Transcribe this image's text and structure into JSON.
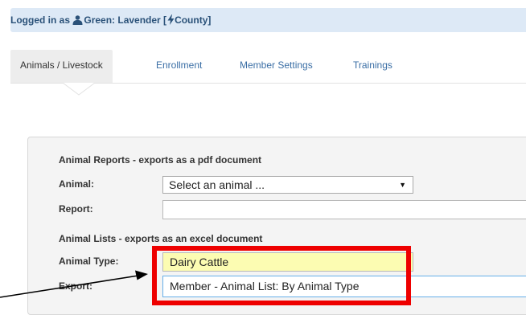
{
  "login_bar": {
    "prefix": "Logged in as",
    "user": "Green: Lavender [",
    "county": "County]"
  },
  "tabs": [
    {
      "label": "Animals / Livestock",
      "active": true
    },
    {
      "label": "Enrollment",
      "active": false
    },
    {
      "label": "Member Settings",
      "active": false
    },
    {
      "label": "Trainings",
      "active": false
    }
  ],
  "reports": {
    "title": "Animal Reports - exports as a pdf document",
    "animal_label": "Animal:",
    "animal_select": "Select an animal ...",
    "report_label": "Report:",
    "report_value": ""
  },
  "lists": {
    "title": "Animal Lists - exports as an excel document",
    "animal_type_label": "Animal Type:",
    "animal_type_value": "Dairy Cattle",
    "export_label": "Export:",
    "export_value": "Member - Animal List: By Animal Type"
  },
  "colors": {
    "login_bar_bg": "#dde9f6",
    "link": "#3a6ea5",
    "highlight": "#ee0000",
    "yellow_field": "#fcfcb2"
  },
  "icons": {
    "user": "user-icon",
    "bolt": "bolt-icon",
    "dropdown": "dropdown-arrow-icon"
  }
}
